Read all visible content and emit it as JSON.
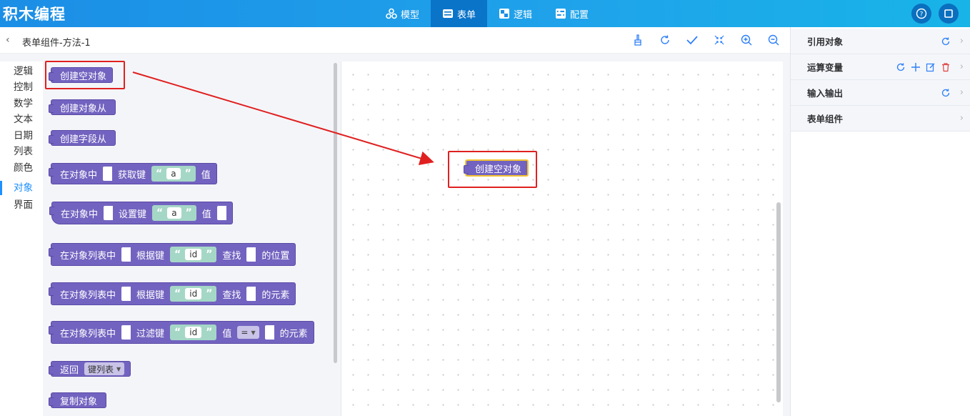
{
  "app": {
    "brand": "积木编程"
  },
  "nav": [
    {
      "label": "模型",
      "icon": "cubes-icon"
    },
    {
      "label": "表单",
      "icon": "form-icon",
      "active": true
    },
    {
      "label": "逻辑",
      "icon": "logic-icon"
    },
    {
      "label": "配置",
      "icon": "config-icon"
    }
  ],
  "subheader": {
    "title": "表单组件-方法-1"
  },
  "categories": [
    "逻辑",
    "控制",
    "数学",
    "文本",
    "日期",
    "列表",
    "颜色",
    "对象",
    "界面"
  ],
  "active_category": "对象",
  "flyout": {
    "create_empty": "创建空对象",
    "create_from": "创建对象从",
    "create_field_from": "创建字段从",
    "get_prefix": "在对象中",
    "get_key": "获取键",
    "get_key_value": "a",
    "get_suffix": "值",
    "set_prefix": "在对象中",
    "set_key": "设置键",
    "set_key_value": "a",
    "set_suffix": "值",
    "pos_prefix": "在对象列表中",
    "pos_by_key": "根据键",
    "pos_key_value": "id",
    "pos_find": "查找",
    "pos_suffix": "的位置",
    "elem_prefix": "在对象列表中",
    "elem_by_key": "根据键",
    "elem_key_value": "id",
    "elem_find": "查找",
    "elem_suffix": "的元素",
    "filter_prefix": "在对象列表中",
    "filter_key": "过滤键",
    "filter_key_value": "id",
    "filter_value": "值",
    "filter_op": "=",
    "filter_suffix": "的元素",
    "return_label": "返回",
    "return_option": "键列表",
    "copy_object": "复制对象"
  },
  "workspace": {
    "block_label": "创建空对象"
  },
  "right_panel": [
    {
      "title": "引用对象"
    },
    {
      "title": "运算变量"
    },
    {
      "title": "输入输出"
    },
    {
      "title": "表单组件"
    }
  ],
  "colors": {
    "topbar": "#1b8ee6",
    "block": "#7363c0",
    "accent": "#1e90ff",
    "highlight": "#e02020"
  }
}
